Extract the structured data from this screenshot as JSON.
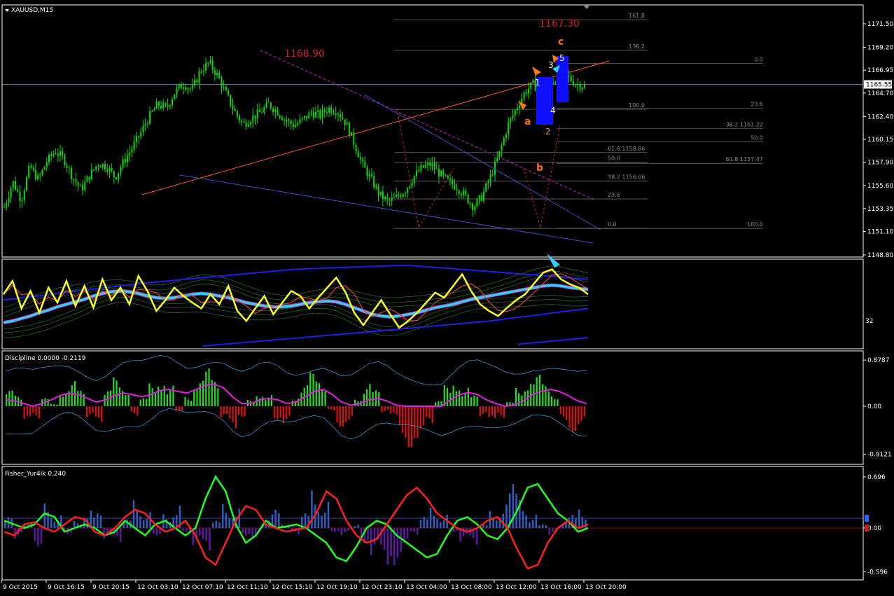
{
  "window": {
    "symbol_title": "XAUUSD,M15"
  },
  "colors": {
    "background": "#000000",
    "frame": "#ffffff",
    "bull_candle": "#00e000",
    "trend_orange": "#ff5a1e",
    "trend_blue": "#3e4ec8",
    "magenta_dashed": "#d020d0",
    "fib_gray": "#6a6a6a",
    "yellow_line": "#ffff20",
    "thick_cyan": "#30d0ff",
    "hist_green": "#20e020",
    "hist_red": "#e01010",
    "fisher_blue": "#2a60c0",
    "fisher_purple": "#6018a0",
    "fisher_green": "#20ff20",
    "fisher_red": "#ff2020"
  },
  "chart_data": [
    {
      "type": "candlestick",
      "title": "XAUUSD,M15",
      "y_axis_ticks": [
        "1171.50",
        "1169.20",
        "1166.95",
        "1164.70",
        "1162.40",
        "1160.15",
        "1157.90",
        "1155.60",
        "1153.35",
        "1151.10",
        "1148.80"
      ],
      "current_price_label": "1165.55",
      "x_axis_ticks": [
        "9 Oct 2015",
        "9 Oct 16:15",
        "9 Oct 20:15",
        "12 Oct 03:10",
        "12 Oct 07:10",
        "12 Oct 11:10",
        "12 Oct 15:10",
        "12 Oct 19:10",
        "12 Oct 23:10",
        "13 Oct 04:00",
        "13 Oct 08:00",
        "13 Oct 12:00",
        "13 Oct 16:00",
        "13 Oct 20:00"
      ],
      "close_path": [
        1153.5,
        1156.0,
        1154.2,
        1157.5,
        1156.2,
        1158.0,
        1159.0,
        1158.2,
        1156.5,
        1155.2,
        1156.6,
        1157.8,
        1157.5,
        1156.4,
        1158.0,
        1159.3,
        1160.8,
        1162.4,
        1163.6,
        1163.2,
        1164.8,
        1165.6,
        1165.0,
        1166.9,
        1167.7,
        1166.4,
        1164.6,
        1162.9,
        1161.6,
        1162.3,
        1162.8,
        1163.6,
        1162.9,
        1162.0,
        1161.5,
        1162.1,
        1162.8,
        1162.5,
        1163.2,
        1163.0,
        1161.8,
        1159.8,
        1157.6,
        1156.2,
        1154.7,
        1154.0,
        1154.5,
        1155.2,
        1156.5,
        1157.4,
        1157.7,
        1156.8,
        1156.0,
        1155.5,
        1154.6,
        1153.5,
        1154.6,
        1156.5,
        1158.7,
        1161.5,
        1163.2,
        1164.8,
        1165.6,
        1164.4,
        1165.8,
        1166.4,
        1166.3,
        1165.6,
        1165.4
      ],
      "annotations": {
        "level_1168": "1168.90",
        "level_1167": "1167.30",
        "wave_a": "a",
        "wave_b": "b",
        "wave_c": "c",
        "wave_1": "1",
        "wave_2": "2",
        "wave_3": "3",
        "wave_4": "4",
        "wave_5": "5"
      },
      "fib_levels_left": [
        {
          "text": "61.8 1158.86"
        },
        {
          "text": "50.0"
        },
        {
          "text": "38.2 1156.06"
        },
        {
          "text": "23.6"
        },
        {
          "text": "0.0"
        }
      ],
      "fib_levels_mid": [
        {
          "text": "161.8"
        },
        {
          "text": "138.2"
        },
        {
          "text": "100.0"
        }
      ],
      "fib_levels_right": [
        {
          "text": "0.0"
        },
        {
          "text": "23.6"
        },
        {
          "text": "38.2 1161.22"
        },
        {
          "text": "50.0"
        },
        {
          "text": "61.8 1157.47"
        },
        {
          "text": "100.0"
        }
      ]
    },
    {
      "type": "line",
      "title": "",
      "y_axis_ticks": [
        "32"
      ],
      "yellow_series": [
        0.62,
        0.78,
        0.45,
        0.66,
        0.4,
        0.7,
        0.52,
        0.78,
        0.48,
        0.72,
        0.46,
        0.8,
        0.55,
        0.7,
        0.5,
        0.84,
        0.66,
        0.42,
        0.55,
        0.7,
        0.6,
        0.52,
        0.45,
        0.62,
        0.5,
        0.72,
        0.42,
        0.3,
        0.45,
        0.6,
        0.38,
        0.52,
        0.66,
        0.6,
        0.45,
        0.58,
        0.7,
        0.82,
        0.65,
        0.4,
        0.25,
        0.4,
        0.55,
        0.38,
        0.22,
        0.3,
        0.4,
        0.52,
        0.64,
        0.58,
        0.72,
        0.86,
        0.66,
        0.5,
        0.42,
        0.36,
        0.46,
        0.55,
        0.62,
        0.75,
        0.88,
        0.92,
        0.8,
        0.74,
        0.7,
        0.62
      ],
      "cyan_series": [
        0.28,
        0.3,
        0.33,
        0.36,
        0.4,
        0.43,
        0.47,
        0.5,
        0.53,
        0.56,
        0.6,
        0.63,
        0.65,
        0.66,
        0.65,
        0.63,
        0.6,
        0.58,
        0.57,
        0.58,
        0.6,
        0.62,
        0.63,
        0.62,
        0.6,
        0.58,
        0.55,
        0.52,
        0.5,
        0.48,
        0.47,
        0.47,
        0.48,
        0.5,
        0.52,
        0.53,
        0.54,
        0.53,
        0.5,
        0.46,
        0.42,
        0.38,
        0.36,
        0.35,
        0.36,
        0.38,
        0.4,
        0.43,
        0.46,
        0.48,
        0.5,
        0.53,
        0.56,
        0.58,
        0.6,
        0.62,
        0.64,
        0.66,
        0.68,
        0.7,
        0.72,
        0.73,
        0.72,
        0.7,
        0.69,
        0.68
      ]
    },
    {
      "type": "bar",
      "title": "Discipline 0.0000 -0.2119",
      "y_axis_ticks": [
        "0.8787",
        "0.00",
        "-0.9121"
      ],
      "values": [
        0.3,
        0.2,
        -0.35,
        -0.25,
        0.15,
        0.05,
        0.35,
        0.48,
        0.3,
        -0.25,
        -0.38,
        0.3,
        0.55,
        0.4,
        -0.2,
        0.15,
        0.45,
        0.62,
        0.4,
        -0.1,
        0.2,
        0.58,
        0.72,
        0.5,
        -0.28,
        -0.48,
        -0.2,
        0.12,
        0.3,
        0.22,
        -0.25,
        -0.35,
        0.2,
        0.4,
        0.65,
        0.55,
        -0.1,
        -0.4,
        -0.3,
        0.18,
        0.45,
        0.3,
        -0.12,
        -0.25,
        -0.6,
        -0.8,
        -0.72,
        -0.4,
        0.1,
        0.4,
        0.55,
        0.38,
        0.2,
        -0.2,
        -0.35,
        -0.22,
        0.08,
        0.4,
        0.55,
        0.6,
        0.42,
        0.25,
        -0.3,
        -0.5,
        -0.35
      ],
      "magenta_series": [
        0.12,
        0.1,
        0.05,
        0.0,
        0.05,
        0.12,
        0.2,
        0.25,
        0.22,
        0.15,
        0.08,
        0.12,
        0.2,
        0.25,
        0.22,
        0.18,
        0.22,
        0.3,
        0.32,
        0.28,
        0.25,
        0.32,
        0.4,
        0.42,
        0.35,
        0.18,
        0.05,
        0.05,
        0.12,
        0.15,
        0.12,
        0.05,
        0.08,
        0.18,
        0.28,
        0.32,
        0.22,
        0.08,
        0.02,
        0.05,
        0.12,
        0.15,
        0.1,
        0.02,
        0.0,
        0.0,
        0.0,
        0.0,
        0.0,
        0.12,
        0.22,
        0.26,
        0.22,
        0.12,
        0.05,
        0.0,
        0.02,
        0.1,
        0.22,
        0.28,
        0.32,
        0.28,
        0.2,
        0.1,
        0.05
      ]
    },
    {
      "type": "bar",
      "title": "Fisher_Yur4ik 0.240",
      "y_axis_ticks": [
        "0.696",
        "0.00",
        "-0.596"
      ],
      "values": [
        0.15,
        -0.15,
        0.08,
        -0.25,
        0.35,
        0.2,
        -0.08,
        0.1,
        0.28,
        0.2,
        -0.15,
        -0.22,
        0.12,
        0.4,
        0.25,
        -0.1,
        0.2,
        0.35,
        -0.05,
        -0.25,
        -0.35,
        0.1,
        0.35,
        0.3,
        -0.1,
        -0.15,
        0.12,
        0.25,
        0.05,
        -0.1,
        0.2,
        0.55,
        0.4,
        -0.05,
        -0.1,
        0.05,
        -0.2,
        -0.4,
        -0.55,
        -0.5,
        -0.35,
        -0.1,
        0.15,
        0.3,
        0.2,
        -0.05,
        -0.2,
        -0.25,
        0.05,
        0.25,
        0.35,
        0.6,
        0.42,
        0.2,
        0.05,
        -0.1,
        0.08,
        0.18,
        0.28
      ],
      "green_series": [
        0.1,
        0.05,
        0.0,
        0.05,
        0.2,
        0.15,
        -0.05,
        0.0,
        0.05,
        0.0,
        -0.1,
        -0.05,
        0.1,
        0.0,
        -0.1,
        0.05,
        0.1,
        0.0,
        -0.1,
        0.0,
        0.4,
        0.7,
        0.5,
        0.05,
        -0.2,
        -0.1,
        0.1,
        0.0,
        0.02,
        0.05,
        0.0,
        -0.1,
        -0.2,
        -0.4,
        -0.45,
        -0.25,
        0.0,
        0.1,
        0.05,
        -0.1,
        -0.2,
        -0.3,
        -0.4,
        -0.35,
        -0.1,
        0.1,
        0.15,
        0.05,
        -0.1,
        -0.15,
        0.0,
        0.25,
        0.55,
        0.6,
        0.4,
        0.2,
        0.1,
        -0.05,
        0.0
      ],
      "red_series": [
        -0.05,
        -0.1,
        0.05,
        0.08,
        0.0,
        -0.05,
        0.05,
        0.15,
        0.12,
        -0.05,
        -0.1,
        0.0,
        0.15,
        0.25,
        0.2,
        0.05,
        -0.05,
        0.0,
        0.1,
        -0.1,
        -0.4,
        -0.5,
        -0.2,
        0.1,
        0.3,
        0.25,
        0.05,
        0.0,
        -0.05,
        -0.02,
        0.0,
        0.2,
        0.5,
        0.4,
        0.1,
        -0.1,
        -0.2,
        -0.15,
        0.05,
        0.25,
        0.45,
        0.55,
        0.4,
        0.2,
        0.1,
        0.0,
        -0.05,
        0.0,
        0.1,
        0.15,
        0.0,
        -0.3,
        -0.55,
        -0.5,
        -0.2,
        0.0,
        0.1,
        0.0,
        0.05
      ]
    }
  ]
}
